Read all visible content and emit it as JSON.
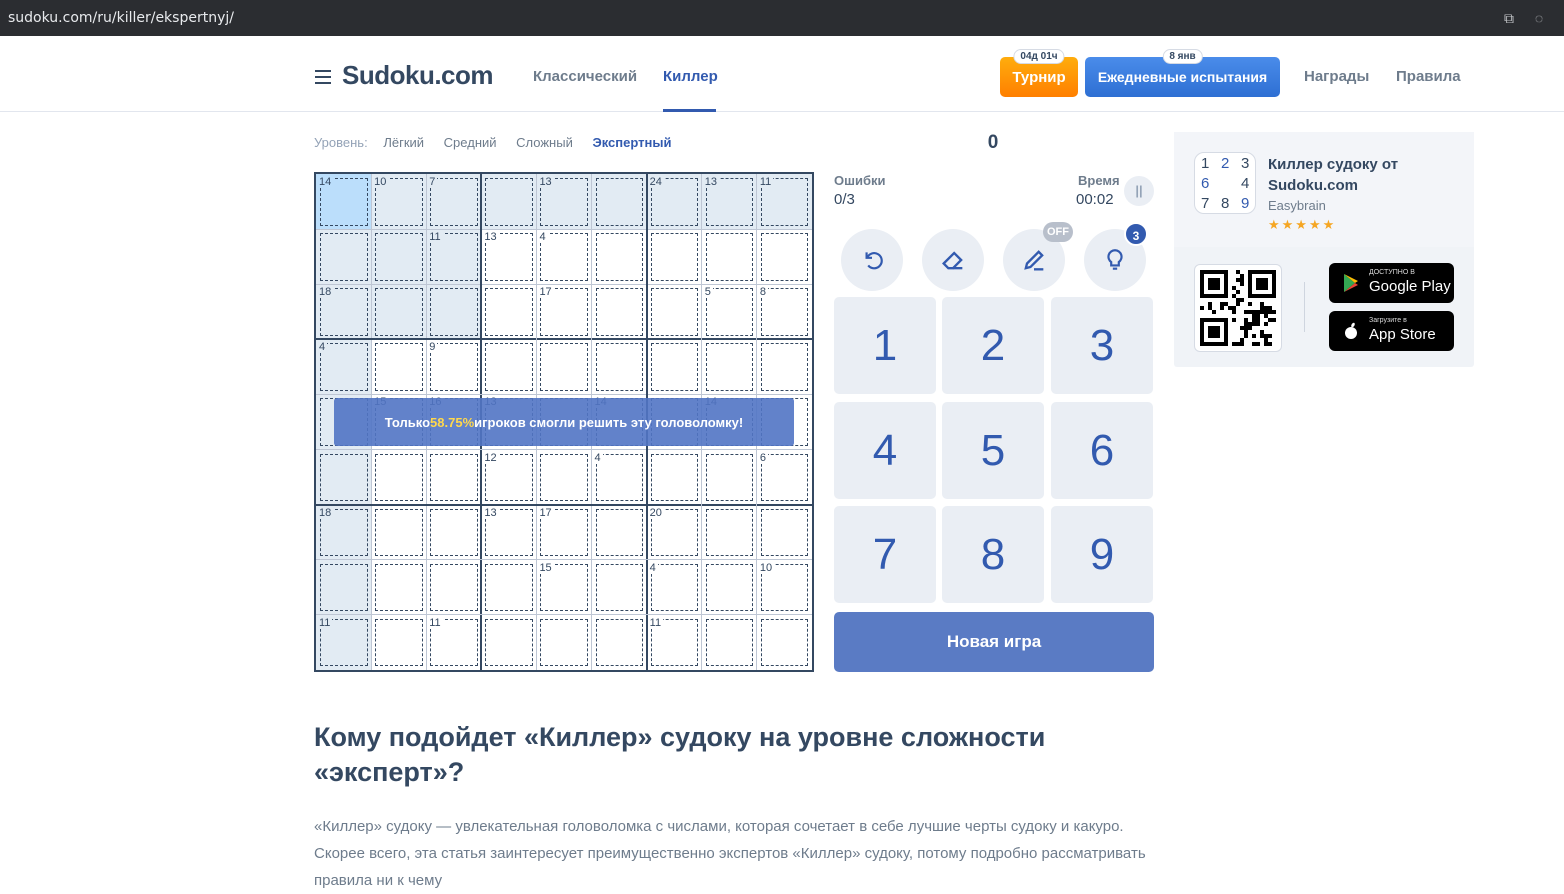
{
  "browser": {
    "url": "sudoku.com/ru/killer/ekspertnyj/"
  },
  "header": {
    "logo": "Sudoku.com",
    "nav": [
      {
        "label": "Классический",
        "active": false
      },
      {
        "label": "Киллер",
        "active": true
      }
    ],
    "tournament": {
      "label": "Турнир",
      "badge": "04д 01ч"
    },
    "daily": {
      "label": "Ежедневные испытания",
      "badge": "8 янв"
    },
    "links": [
      "Награды",
      "Правила"
    ]
  },
  "levels": {
    "label": "Уровень:",
    "items": [
      "Лёгкий",
      "Средний",
      "Сложный",
      "Экспертный"
    ],
    "active": "Экспертный"
  },
  "score": "0",
  "stats": {
    "mistakes_label": "Ошибки",
    "mistakes_value": "0/3",
    "time_label": "Время",
    "time_value": "00:02"
  },
  "tools": {
    "pencil_badge": "OFF",
    "hint_badge": "3"
  },
  "numpad": [
    "1",
    "2",
    "3",
    "4",
    "5",
    "6",
    "7",
    "8",
    "9"
  ],
  "new_game": "Новая игра",
  "toast": {
    "before": "Только ",
    "percent": "58.75%",
    "after": " игроков смогли решить эту головоломку!"
  },
  "board": {
    "selected": [
      0,
      0
    ],
    "cage_sums": [
      {
        "r": 0,
        "c": 0,
        "v": "14"
      },
      {
        "r": 0,
        "c": 1,
        "v": "10"
      },
      {
        "r": 0,
        "c": 2,
        "v": "7"
      },
      {
        "r": 0,
        "c": 4,
        "v": "13"
      },
      {
        "r": 0,
        "c": 6,
        "v": "24"
      },
      {
        "r": 0,
        "c": 7,
        "v": "13"
      },
      {
        "r": 0,
        "c": 8,
        "v": "11"
      },
      {
        "r": 1,
        "c": 2,
        "v": "11"
      },
      {
        "r": 1,
        "c": 3,
        "v": "13"
      },
      {
        "r": 1,
        "c": 4,
        "v": "4"
      },
      {
        "r": 2,
        "c": 0,
        "v": "18"
      },
      {
        "r": 2,
        "c": 4,
        "v": "17"
      },
      {
        "r": 2,
        "c": 7,
        "v": "5"
      },
      {
        "r": 2,
        "c": 8,
        "v": "8"
      },
      {
        "r": 3,
        "c": 0,
        "v": "4"
      },
      {
        "r": 3,
        "c": 2,
        "v": "9"
      },
      {
        "r": 4,
        "c": 1,
        "v": "15"
      },
      {
        "r": 4,
        "c": 2,
        "v": "16"
      },
      {
        "r": 4,
        "c": 3,
        "v": "13"
      },
      {
        "r": 4,
        "c": 5,
        "v": "14"
      },
      {
        "r": 4,
        "c": 7,
        "v": "14"
      },
      {
        "r": 5,
        "c": 3,
        "v": "12"
      },
      {
        "r": 5,
        "c": 5,
        "v": "4"
      },
      {
        "r": 5,
        "c": 8,
        "v": "6"
      },
      {
        "r": 6,
        "c": 0,
        "v": "18"
      },
      {
        "r": 6,
        "c": 3,
        "v": "13"
      },
      {
        "r": 6,
        "c": 4,
        "v": "17"
      },
      {
        "r": 6,
        "c": 6,
        "v": "20"
      },
      {
        "r": 7,
        "c": 4,
        "v": "15"
      },
      {
        "r": 7,
        "c": 6,
        "v": "4"
      },
      {
        "r": 7,
        "c": 8,
        "v": "10"
      },
      {
        "r": 8,
        "c": 0,
        "v": "11"
      },
      {
        "r": 8,
        "c": 2,
        "v": "11"
      },
      {
        "r": 8,
        "c": 6,
        "v": "11"
      }
    ]
  },
  "promo": {
    "title": "Киллер судоку от Sudoku.com",
    "developer": "Easybrain",
    "rating": "★★★★★",
    "icon_digits": [
      "1",
      "2",
      "3",
      "6",
      "4",
      "7",
      "8",
      "9"
    ],
    "google_small": "ДОСТУПНО В",
    "google_big": "Google Play",
    "apple_small": "Загрузите в",
    "apple_big": "App Store"
  },
  "article": {
    "heading": "Кому подойдет «Киллер» судоку на уровне сложности «эксперт»?",
    "paragraph": "«Киллер» судоку — увлекательная головоломка с числами, которая сочетает в себе лучшие черты судоку и какуро. Скорее всего, эта статья заинтересует преимущественно экспертов «Киллер» судоку, потому подробно рассматривать правила ни к чему"
  },
  "colors": {
    "accent": "#325aaf",
    "highlight": "#e2ebf3",
    "selected": "#bbdefb",
    "orange": "#ff8f00"
  }
}
